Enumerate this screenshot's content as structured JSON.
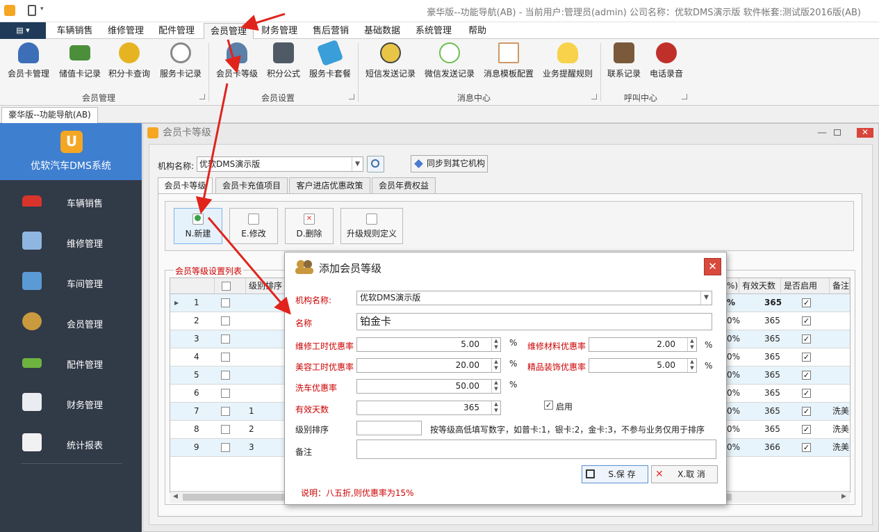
{
  "window": {
    "title": "豪华版--功能导航(AB) - 当前用户:管理员(admin) 公司名称：优软DMS演示版 软件帐套:测试版2016版(AB)"
  },
  "menu": {
    "tabs": [
      "车辆销售",
      "维修管理",
      "配件管理",
      "会员管理",
      "财务管理",
      "售后营销",
      "基础数据",
      "系统管理",
      "帮助"
    ],
    "active": "会员管理"
  },
  "ribbon": {
    "buttons": [
      "会员卡管理",
      "储值卡记录",
      "积分卡查询",
      "服务卡记录",
      "会员卡等级",
      "积分公式",
      "服务卡套餐",
      "短信发送记录",
      "微信发送记录",
      "消息模板配置",
      "业务提醒规则",
      "联系记录",
      "电话录音"
    ],
    "groups": [
      "会员管理",
      "会员设置",
      "消息中心",
      "呼叫中心"
    ]
  },
  "doc_tab": "豪华版--功能导航(AB)",
  "sidebar": {
    "title": "优软汽车DMS系统",
    "items": [
      "车辆销售",
      "维修管理",
      "车间管理",
      "会员管理",
      "配件管理",
      "财务管理",
      "统计报表"
    ]
  },
  "main": {
    "title": "会员卡等级",
    "org_label": "机构名称:",
    "org_value": "优软DMS演示版",
    "sync_button": "同步到其它机构",
    "tabs": [
      "会员卡等级",
      "会员卡充值项目",
      "客户进店优惠政策",
      "会员年费权益"
    ],
    "toolbar": {
      "new": "N.新建",
      "edit": "E.修改",
      "delete": "D.删除",
      "upgrade": "升级规则定义"
    },
    "grid_title": "会员等级设置列表",
    "grid_headers": {
      "order": "级别排序",
      "pct": "%)",
      "days": "有效天数",
      "enabled": "是否启用",
      "note": "备注"
    },
    "rows": [
      {
        "no": "1",
        "order": "",
        "pct": "%",
        "days": "365",
        "note": ""
      },
      {
        "no": "2",
        "order": "",
        "pct": "0%",
        "days": "365",
        "note": ""
      },
      {
        "no": "3",
        "order": "",
        "pct": "0%",
        "days": "365",
        "note": ""
      },
      {
        "no": "4",
        "order": "",
        "pct": "0%",
        "days": "365",
        "note": ""
      },
      {
        "no": "5",
        "order": "",
        "pct": "0%",
        "days": "365",
        "note": ""
      },
      {
        "no": "6",
        "order": "",
        "pct": "0%",
        "days": "365",
        "note": ""
      },
      {
        "no": "7",
        "order": "1",
        "pct": "0%",
        "days": "365",
        "note": "洗美"
      },
      {
        "no": "8",
        "order": "2",
        "pct": "0%",
        "days": "365",
        "note": "洗美"
      },
      {
        "no": "9",
        "order": "3",
        "pct": "0%",
        "days": "366",
        "note": "洗美"
      }
    ]
  },
  "dialog": {
    "title": "添加会员等级",
    "org_label": "机构名称:",
    "org_value": "优软DMS演示版",
    "name_label": "名称",
    "name_value": "铂金卡",
    "repair_hour_label": "维修工时优惠率",
    "repair_hour_value": "5.00",
    "repair_material_label": "维修材料优惠率",
    "repair_material_value": "2.00",
    "beauty_hour_label": "美容工时优惠率",
    "beauty_hour_value": "20.00",
    "decor_label": "精品装饰优惠率",
    "decor_value": "5.00",
    "wash_label": "洗车优惠率",
    "wash_value": "50.00",
    "days_label": "有效天数",
    "days_value": "365",
    "enable_label": "启用",
    "order_label": "级别排序",
    "order_value": "",
    "order_hint": "按等级高低填写数字，如普卡:1，银卡:2，金卡:3，不参与业务仅用于排序",
    "remark_label": "备注",
    "remark_value": "",
    "percent": "%",
    "save": "S.保 存",
    "cancel": "X.取 消",
    "note": "说明：八五折,则优惠率为15%"
  }
}
